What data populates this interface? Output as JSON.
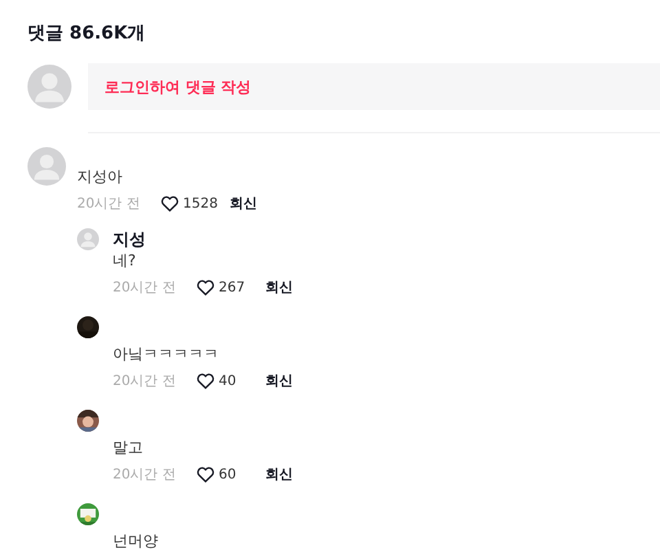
{
  "heading": "댓글 86.6K개",
  "composer": {
    "placeholder": "로그인하여 댓글 작성",
    "avatar": {
      "kind": "default"
    }
  },
  "comments": [
    {
      "avatar": {
        "kind": "default"
      },
      "text": "지성아",
      "time": "20시간 전",
      "likes": "1528",
      "reply": "회신",
      "replies": [
        {
          "avatar": {
            "kind": "default"
          },
          "name": "지성",
          "text": "네?",
          "time": "20시간 전",
          "likes": "267",
          "reply": "회신"
        },
        {
          "text": "아닠ㅋㅋㅋㅋㅋ",
          "time": "20시간 전",
          "likes": "40",
          "reply": "회신"
        },
        {
          "text": "말고",
          "time": "20시간 전",
          "likes": "60",
          "reply": "회신"
        },
        {
          "text": "넌머양"
        }
      ]
    }
  ]
}
